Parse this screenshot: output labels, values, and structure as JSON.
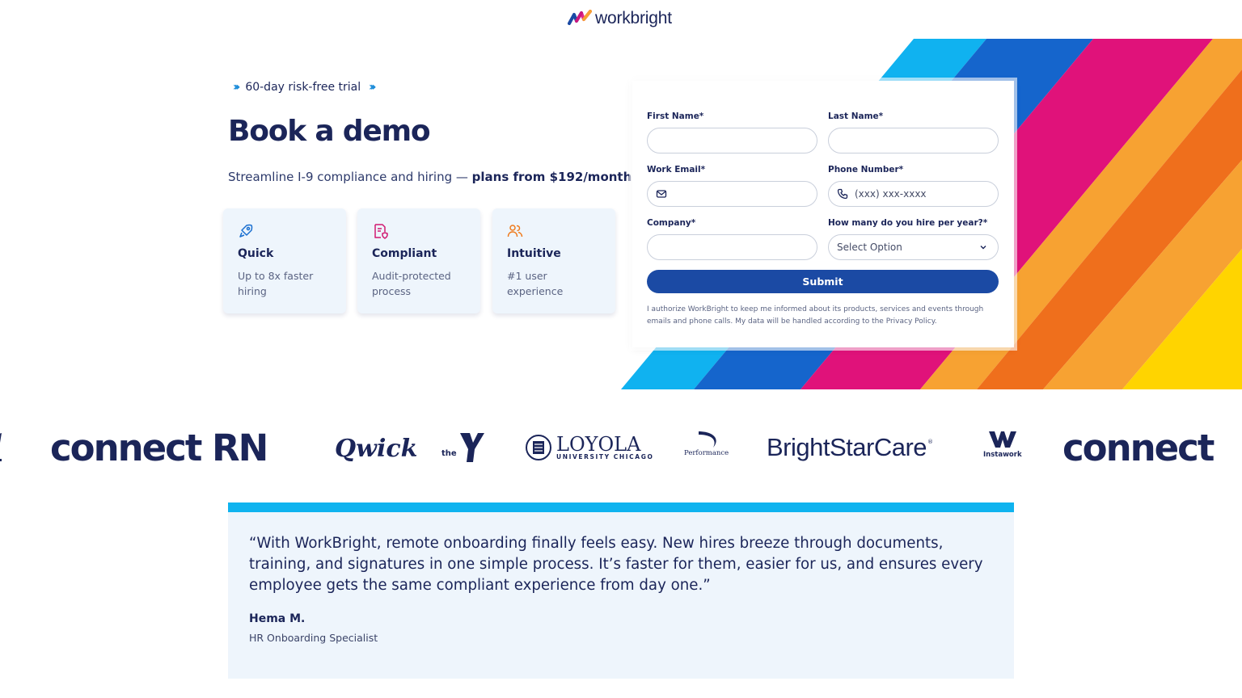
{
  "brand": {
    "name": "workbright",
    "colors": {
      "navy": "#1b2559",
      "blue": "#1b4aa4",
      "cyan": "#0fb3ef",
      "pink": "#e0127a",
      "orange": "#f7a232",
      "yellow": "#ffd400"
    }
  },
  "hero": {
    "trial": "60-day risk-free trial",
    "title": "Book a demo",
    "subtitle_lead": "Streamline I-9 compliance and hiring —",
    "subtitle_bold": "plans from $192/month."
  },
  "features": [
    {
      "icon": "rocket-icon",
      "title": "Quick",
      "desc": "Up to 8x faster hiring"
    },
    {
      "icon": "document-shield-icon",
      "title": "Compliant",
      "desc": "Audit-protected process"
    },
    {
      "icon": "users-icon",
      "title": "Intuitive",
      "desc": "#1 user experience"
    }
  ],
  "form": {
    "first_name": {
      "label": "First Name*",
      "value": "",
      "placeholder": ""
    },
    "last_name": {
      "label": "Last Name*",
      "value": "",
      "placeholder": ""
    },
    "work_email": {
      "label": "Work Email*",
      "value": "",
      "placeholder": ""
    },
    "phone": {
      "label": "Phone Number*",
      "value": "",
      "placeholder": "(xxx) xxx-xxxx"
    },
    "company": {
      "label": "Company*",
      "value": "",
      "placeholder": ""
    },
    "hires": {
      "label": "How many do you hire per year?*",
      "selected": "Select Option"
    },
    "submit": "Submit",
    "consent": "I authorize WorkBright to keep me informed about its products, services and events through emails and phone calls. My data will be handled according to the Privacy Policy."
  },
  "logos": {
    "connect": "connect RN",
    "qwick": "Qwick",
    "ymca_the": "the",
    "loyola_main": "LOYOLA",
    "loyola_sub": "UNIVERSITY CHICAGO",
    "performance": "Performance",
    "brightstar": "BrightStarCare",
    "instawork": "Instawork",
    "connect_repeat": "connect"
  },
  "testimonial": {
    "quote": "“With WorkBright, remote onboarding finally feels easy. New hires breeze through documents, training, and signatures in one simple process. It’s faster for them, easier for us, and ensures every employee gets the same compliant experience from day one.”",
    "author": "Hema M.",
    "role": "HR Onboarding Specialist"
  }
}
